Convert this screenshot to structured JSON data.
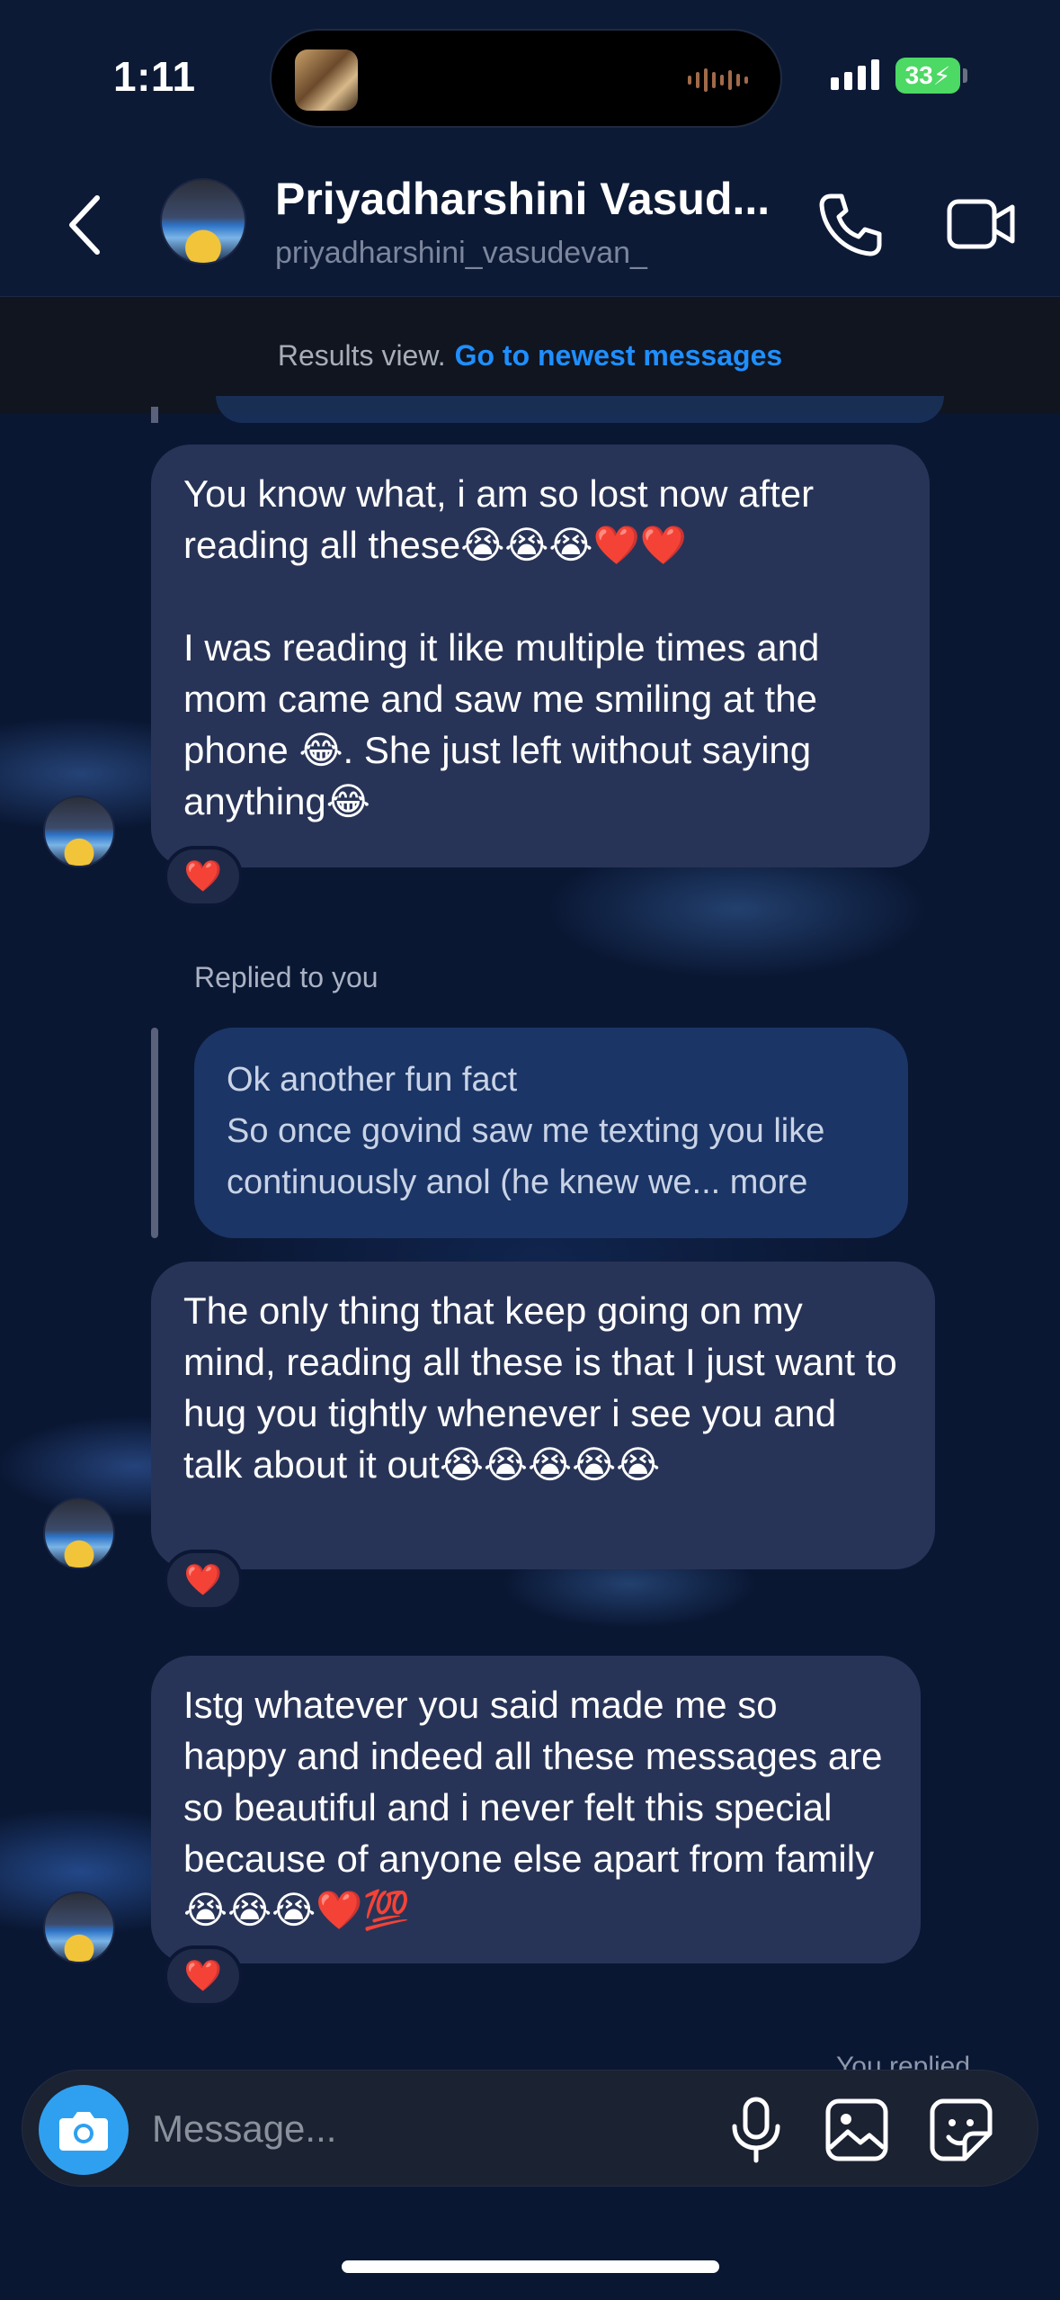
{
  "status_bar": {
    "time": "1:11",
    "battery": "33"
  },
  "header": {
    "name": "Priyadharshini Vasud...",
    "handle": "priyadharshini_vasudevan_"
  },
  "results_bar": {
    "label": "Results view.",
    "link": "Go to newest messages"
  },
  "messages": [
    {
      "text": "You know what, i am so lost now after reading all these😭😭😭❤️❤️\n\nI was reading it like multiple times and mom came and saw me smiling at the phone 😂. She just left without saying anything😂",
      "reaction": "❤️"
    },
    {
      "text": "The only thing that keep going on my mind, reading all these is that I just want to hug you tightly whenever i see you and talk about it out😭😭😭😭😭",
      "reaction": "❤️"
    },
    {
      "text": "Istg whatever you said made me so happy and indeed all these messages are so beautiful and i never felt this special because of anyone else apart from family😭😭😭❤️💯",
      "reaction": "❤️"
    }
  ],
  "reply": {
    "label": "Replied to you",
    "title": "Ok another fun fact",
    "preview": "So once govind saw me texting you like continuously anol (he knew we... more"
  },
  "partial_bottom": "You replied",
  "composer": {
    "placeholder": "Message..."
  },
  "colors": {
    "accent": "#1f8fff",
    "bubble": "#283457",
    "reply_bubble": "#1b3566",
    "camera": "#2fa0f0"
  }
}
